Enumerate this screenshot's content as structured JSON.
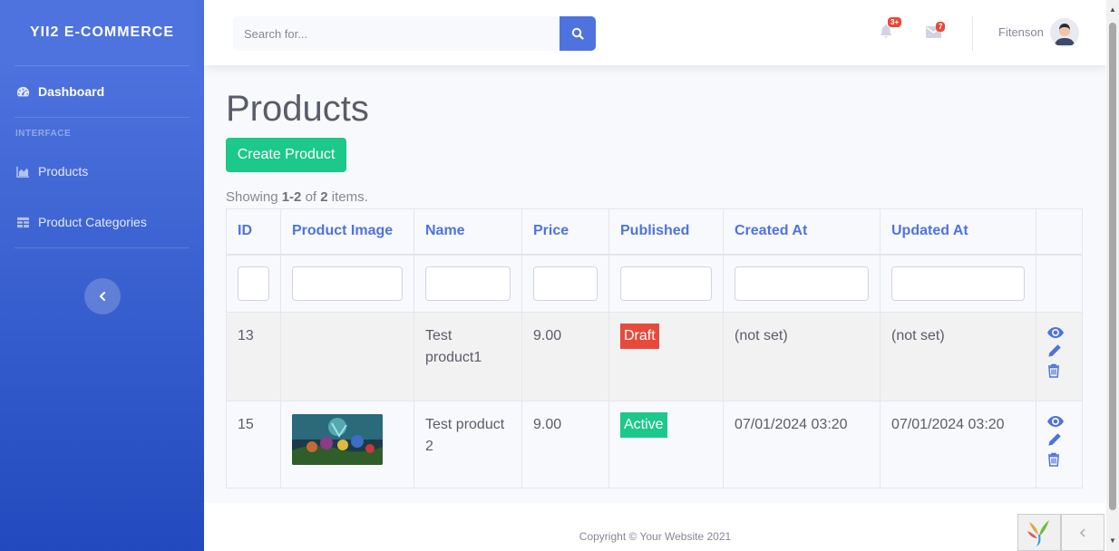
{
  "sidebar": {
    "brand": "YII2 E-COMMERCE",
    "dashboard_label": "Dashboard",
    "heading": "INTERFACE",
    "items": [
      {
        "label": "Products",
        "icon": "chart-area-icon"
      },
      {
        "label": "Product Categories",
        "icon": "table-icon"
      }
    ],
    "toggle_icon": "chevron-left-icon"
  },
  "topbar": {
    "search_placeholder": "Search for...",
    "alerts_badge": "3+",
    "messages_badge": "7",
    "username": "Fitenson"
  },
  "page": {
    "title": "Products",
    "create_button": "Create Product",
    "summary_prefix": "Showing ",
    "summary_range": "1-2",
    "summary_mid": " of ",
    "summary_total": "2",
    "summary_suffix": " items."
  },
  "table": {
    "columns": [
      "ID",
      "Product Image",
      "Name",
      "Price",
      "Published",
      "Created At",
      "Updated At"
    ],
    "rows": [
      {
        "id": "13",
        "image": "",
        "name": "Test product1",
        "price": "9.00",
        "published": "Draft",
        "published_color": "#e74a3b",
        "created_at": "(not set)",
        "updated_at": "(not set)"
      },
      {
        "id": "15",
        "image": "product-thumbnail",
        "name": "Test product 2",
        "price": "9.00",
        "published": "Active",
        "published_color": "#1cc88a",
        "created_at": "07/01/2024 03:20",
        "updated_at": "07/01/2024 03:20"
      }
    ]
  },
  "footer": {
    "copyright": "Copyright © Your Website 2021"
  },
  "colors": {
    "primary": "#4e73df",
    "success": "#1cc88a",
    "danger": "#e74a3b"
  }
}
